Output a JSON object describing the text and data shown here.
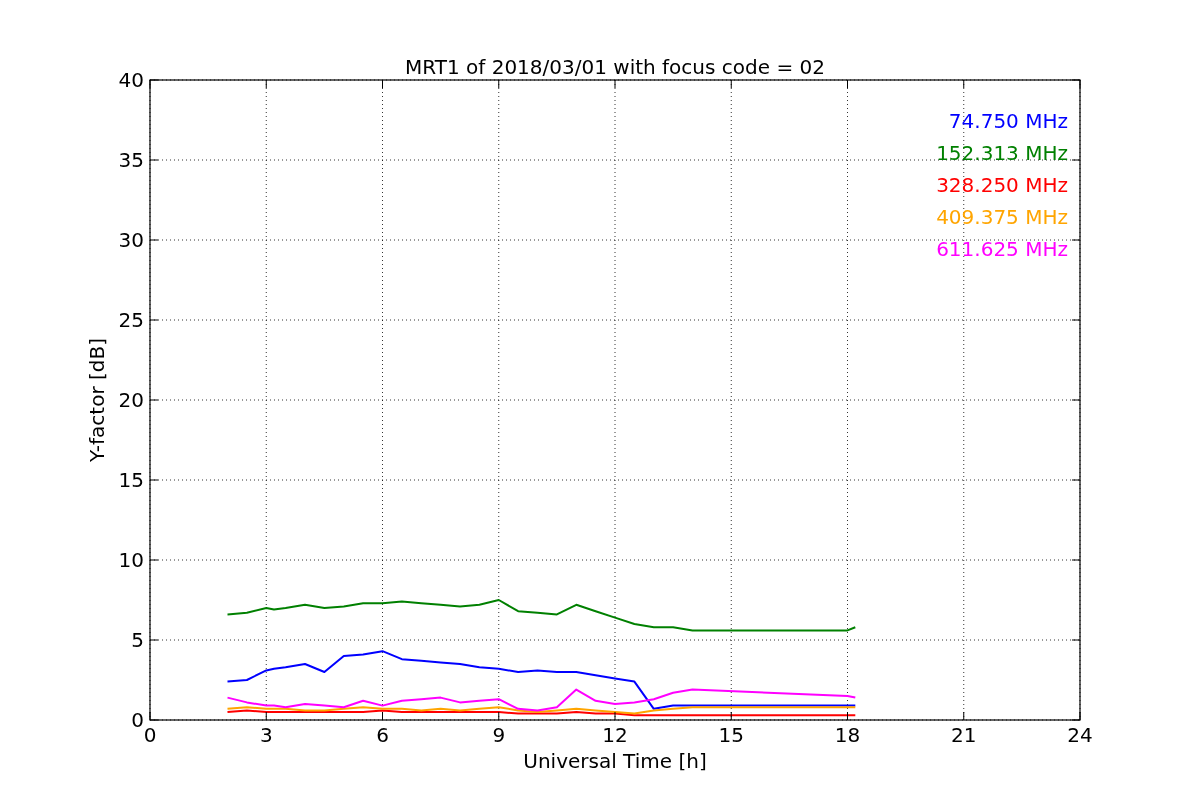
{
  "figure": {
    "chart_data": {
      "type": "line",
      "title": "MRT1 of 2018/03/01 with focus code = 02",
      "xlabel": "Universal Time [h]",
      "ylabel": "Y-factor [dB]",
      "xlim": [
        0,
        24
      ],
      "ylim": [
        0,
        40
      ],
      "xticks": [
        0,
        3,
        6,
        9,
        12,
        15,
        18,
        21,
        24
      ],
      "yticks": [
        0,
        5,
        10,
        15,
        20,
        25,
        30,
        35,
        40
      ],
      "grid": true,
      "x": [
        2,
        2.5,
        3,
        3.2,
        3.5,
        4,
        4.5,
        5,
        5.5,
        6,
        6.5,
        7,
        7.5,
        8,
        8.5,
        9,
        9.5,
        10,
        10.5,
        11,
        11.5,
        12,
        12.5,
        13,
        13.5,
        14,
        18,
        18.2
      ],
      "series": [
        {
          "name": "74.750 MHz",
          "color": "#0000ff",
          "values": [
            2.4,
            2.5,
            3.1,
            3.2,
            3.3,
            3.5,
            3.0,
            4.0,
            4.1,
            4.3,
            3.8,
            3.7,
            3.6,
            3.5,
            3.3,
            3.2,
            3.0,
            3.1,
            3.0,
            3.0,
            2.8,
            2.6,
            2.4,
            0.7,
            0.9,
            0.9,
            0.9,
            0.9
          ]
        },
        {
          "name": "152.313 MHz",
          "color": "#008000",
          "values": [
            6.6,
            6.7,
            7.0,
            6.9,
            7.0,
            7.2,
            7.0,
            7.1,
            7.3,
            7.3,
            7.4,
            7.3,
            7.2,
            7.1,
            7.2,
            7.5,
            6.8,
            6.7,
            6.6,
            7.2,
            6.8,
            6.4,
            6.0,
            5.8,
            5.8,
            5.6,
            5.6,
            5.8
          ]
        },
        {
          "name": "328.250 MHz",
          "color": "#ff0000",
          "values": [
            0.5,
            0.6,
            0.5,
            0.5,
            0.5,
            0.5,
            0.5,
            0.5,
            0.5,
            0.6,
            0.5,
            0.5,
            0.5,
            0.5,
            0.5,
            0.5,
            0.4,
            0.4,
            0.4,
            0.5,
            0.4,
            0.4,
            0.3,
            0.3,
            0.3,
            0.3,
            0.3,
            0.3
          ]
        },
        {
          "name": "409.375 MHz",
          "color": "#ffa500",
          "values": [
            0.7,
            0.8,
            0.7,
            0.7,
            0.7,
            0.6,
            0.6,
            0.7,
            0.8,
            0.7,
            0.7,
            0.6,
            0.7,
            0.6,
            0.7,
            0.8,
            0.6,
            0.5,
            0.6,
            0.7,
            0.6,
            0.5,
            0.4,
            0.6,
            0.7,
            0.8,
            0.8,
            0.8
          ]
        },
        {
          "name": "611.625 MHz",
          "color": "#ff00ff",
          "values": [
            1.4,
            1.1,
            0.9,
            0.9,
            0.8,
            1.0,
            0.9,
            0.8,
            1.2,
            0.9,
            1.2,
            1.3,
            1.4,
            1.1,
            1.2,
            1.3,
            0.7,
            0.6,
            0.8,
            1.9,
            1.2,
            1.0,
            1.1,
            1.3,
            1.7,
            1.9,
            1.5,
            1.4
          ]
        }
      ]
    }
  }
}
